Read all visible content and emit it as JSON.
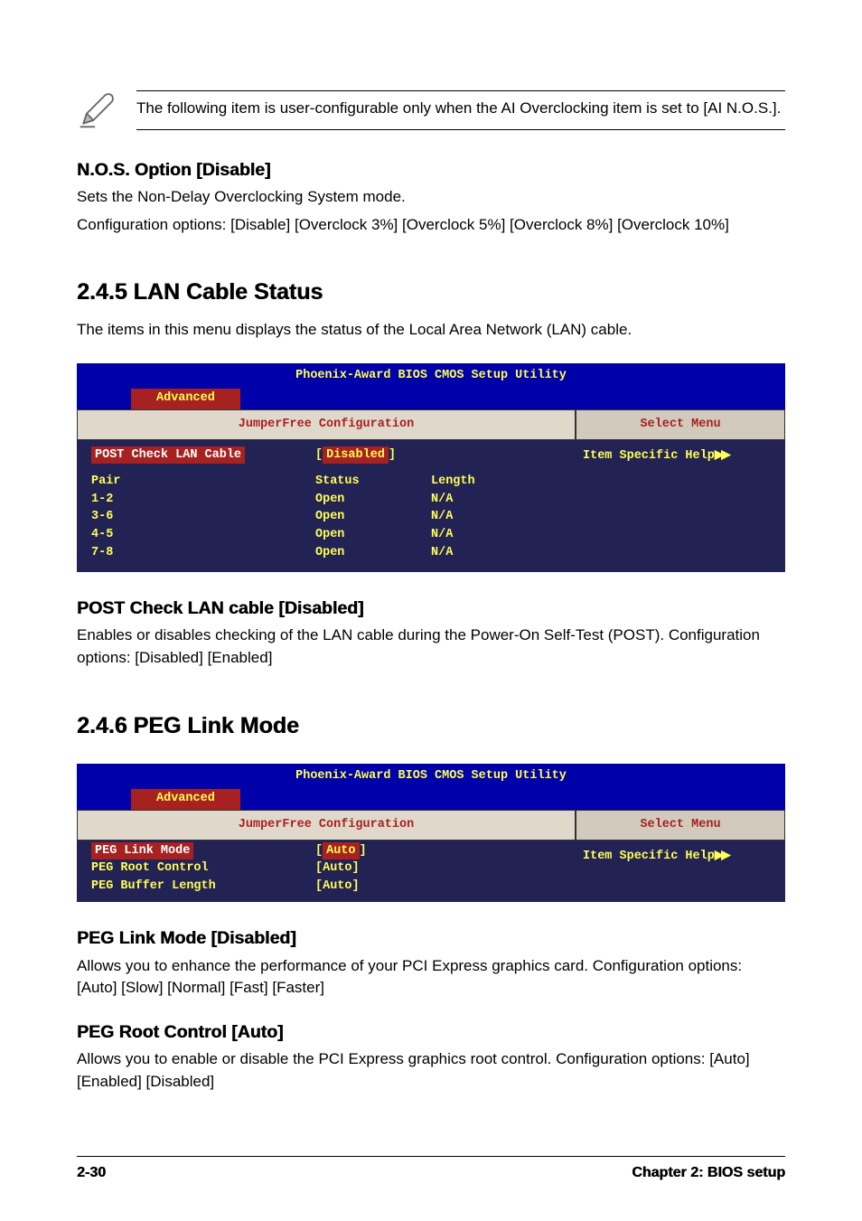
{
  "note": {
    "text": "The following item is user-configurable only when the AI Overclocking item is set to [AI N.O.S.]."
  },
  "nos": {
    "heading": "N.O.S. Option [Disable]",
    "line1": "Sets the Non-Delay Overclocking System mode.",
    "line2": "Configuration options: [Disable] [Overclock 3%] [Overclock 5%] [Overclock 8%] [Overclock 10%]"
  },
  "section245": {
    "heading": "2.4.5   LAN Cable Status",
    "intro": "The items in this menu displays the status of the Local Area Network (LAN) cable."
  },
  "bios_common": {
    "title": "Phoenix-Award BIOS CMOS Setup Utility",
    "tab": "Advanced",
    "left_heading": "JumperFree Configuration",
    "right_heading": "Select Menu",
    "help": "Item Specific Help"
  },
  "bios_lan": {
    "selected_item": "POST Check LAN Cable",
    "selected_value": "Disabled",
    "header": {
      "c1": "Pair",
      "c2": "Status",
      "c3": "Length"
    },
    "rows": [
      {
        "c1": "1-2",
        "c2": "Open",
        "c3": "N/A"
      },
      {
        "c1": "3-6",
        "c2": "Open",
        "c3": "N/A"
      },
      {
        "c1": "4-5",
        "c2": "Open",
        "c3": "N/A"
      },
      {
        "c1": "7-8",
        "c2": "Open",
        "c3": "N/A"
      }
    ]
  },
  "post_check": {
    "heading": "POST Check LAN cable [Disabled]",
    "body": "Enables or disables checking of the LAN cable during the Power-On Self-Test (POST). Configuration options: [Disabled] [Enabled]"
  },
  "section246": {
    "heading": "2.4.6   PEG Link Mode"
  },
  "bios_peg": {
    "selected_item": "PEG Link Mode",
    "selected_value": "Auto",
    "rows": [
      {
        "c1": "PEG Root Control",
        "c2": "[Auto]"
      },
      {
        "c1": "PEG Buffer Length",
        "c2": "[Auto]"
      }
    ]
  },
  "peg_link": {
    "heading": "PEG Link Mode [Disabled]",
    "body": "Allows you to enhance the performance of your PCI Express graphics card. Configuration options: [Auto] [Slow] [Normal] [Fast] [Faster]"
  },
  "peg_root": {
    "heading": "PEG Root Control [Auto]",
    "body": "Allows you to enable or disable the PCI Express graphics root control. Configuration options: [Auto] [Enabled] [Disabled]"
  },
  "footer": {
    "page": "2-30",
    "chapter": "Chapter 2: BIOS setup"
  }
}
